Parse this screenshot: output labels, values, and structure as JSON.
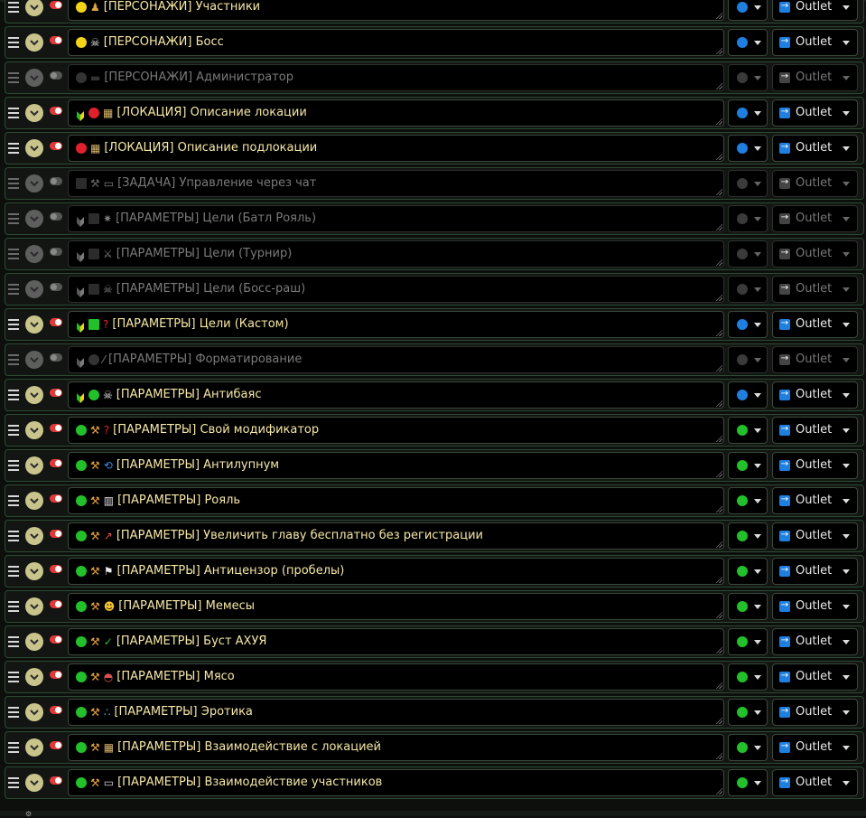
{
  "colors": {
    "accent_blue": "#1e7fe0",
    "active_green": "#22c02a",
    "toggle_red": "#e23a3a",
    "name_text": "#f6e8a6"
  },
  "rows": [
    {
      "enabled": true,
      "icons": [
        "yellow-dot-icon",
        "person-icon"
      ],
      "name": "[ПЕРСОНАЖИ] Участники",
      "color": "#1e7fe0",
      "target": "Outlet"
    },
    {
      "enabled": true,
      "icons": [
        "yellow-dot-icon",
        "skull-icon"
      ],
      "name": "[ПЕРСОНАЖИ] Босс",
      "color": "#1e7fe0",
      "target": "Outlet"
    },
    {
      "enabled": false,
      "icons": [
        "grey-dot-icon",
        "top-hat-icon"
      ],
      "name": "[ПЕРСОНАЖИ] Администратор",
      "color": "#3a3a3a",
      "target": "Outlet"
    },
    {
      "enabled": true,
      "icons": [
        "leaf-icon",
        "red-dot-icon",
        "map-icon"
      ],
      "name": "[ЛОКАЦИЯ] Описание локации",
      "color": "#1e7fe0",
      "target": "Outlet"
    },
    {
      "enabled": true,
      "icons": [
        "red-dot-icon",
        "map-icon"
      ],
      "name": "[ЛОКАЦИЯ] Описание подлокации",
      "color": "#1e7fe0",
      "target": "Outlet"
    },
    {
      "enabled": false,
      "icons": [
        "grey-square-icon",
        "wrench-icon",
        "speech-bubble-icon"
      ],
      "name": "[ЗАДАЧА] Управление через чат",
      "color": "#3a3a3a",
      "target": "Outlet"
    },
    {
      "enabled": false,
      "icons": [
        "leaf-icon",
        "grey-square-icon",
        "burst-icon"
      ],
      "name": "[ПАРАМЕТРЫ] Цели (Батл Рояль)",
      "color": "#3a3a3a",
      "target": "Outlet"
    },
    {
      "enabled": false,
      "icons": [
        "leaf-icon",
        "grey-square-icon",
        "crossed-swords-icon"
      ],
      "name": "[ПАРАМЕТРЫ] Цели (Турнир)",
      "color": "#3a3a3a",
      "target": "Outlet"
    },
    {
      "enabled": false,
      "icons": [
        "leaf-icon",
        "grey-square-icon",
        "skull-crossbones-icon"
      ],
      "name": "[ПАРАМЕТРЫ] Цели (Босс-раш)",
      "color": "#3a3a3a",
      "target": "Outlet"
    },
    {
      "enabled": true,
      "icons": [
        "leaf-icon",
        "green-square-icon",
        "question-icon"
      ],
      "name": "[ПАРАМЕТРЫ] Цели (Кастом)",
      "color": "#1e7fe0",
      "target": "Outlet"
    },
    {
      "enabled": false,
      "icons": [
        "leaf-icon",
        "grey-dot-icon",
        "feather-icon"
      ],
      "name": "[ПАРАМЕТРЫ] Форматирование",
      "color": "#3a3a3a",
      "target": "Outlet"
    },
    {
      "enabled": true,
      "icons": [
        "leaf-icon",
        "green-dot-icon",
        "skull-icon"
      ],
      "name": "[ПАРАМЕТРЫ] Антибаяс",
      "color": "#1e7fe0",
      "target": "Outlet"
    },
    {
      "enabled": true,
      "icons": [
        "green-dot-icon",
        "wrench-icon",
        "question-icon"
      ],
      "name": "[ПАРАМЕТРЫ] Свой модификатор",
      "color": "#22c02a",
      "target": "Outlet"
    },
    {
      "enabled": true,
      "icons": [
        "green-dot-icon",
        "wrench-icon",
        "repeat-icon"
      ],
      "name": "[ПАРАМЕТРЫ] Антилупнум",
      "color": "#22c02a",
      "target": "Outlet"
    },
    {
      "enabled": true,
      "icons": [
        "green-dot-icon",
        "wrench-icon",
        "piano-icon"
      ],
      "name": "[ПАРАМЕТРЫ] Рояль",
      "color": "#22c02a",
      "target": "Outlet"
    },
    {
      "enabled": true,
      "icons": [
        "green-dot-icon",
        "wrench-icon",
        "chart-up-icon"
      ],
      "name": "[ПАРАМЕТРЫ] Увеличить главу бесплатно без регистрации",
      "color": "#22c02a",
      "target": "Outlet"
    },
    {
      "enabled": true,
      "icons": [
        "green-dot-icon",
        "wrench-icon",
        "pirate-flag-icon"
      ],
      "name": "[ПАРАМЕТРЫ] Антицензор (пробелы)",
      "color": "#22c02a",
      "target": "Outlet"
    },
    {
      "enabled": true,
      "icons": [
        "green-dot-icon",
        "wrench-icon",
        "grin-icon"
      ],
      "name": "[ПАРАМЕТРЫ] Мемесы",
      "color": "#22c02a",
      "target": "Outlet"
    },
    {
      "enabled": true,
      "icons": [
        "green-dot-icon",
        "wrench-icon",
        "check-icon"
      ],
      "name": "[ПАРАМЕТРЫ] Буст АХУЯ",
      "color": "#22c02a",
      "target": "Outlet"
    },
    {
      "enabled": true,
      "icons": [
        "green-dot-icon",
        "wrench-icon",
        "meat-icon"
      ],
      "name": "[ПАРАМЕТРЫ] Мясо",
      "color": "#22c02a",
      "target": "Outlet"
    },
    {
      "enabled": true,
      "icons": [
        "green-dot-icon",
        "wrench-icon",
        "droplets-icon"
      ],
      "name": "[ПАРАМЕТРЫ] Эротика",
      "color": "#22c02a",
      "target": "Outlet"
    },
    {
      "enabled": true,
      "icons": [
        "green-dot-icon",
        "wrench-icon",
        "map-icon"
      ],
      "name": "[ПАРАМЕТРЫ] Взаимодействие с локацией",
      "color": "#22c02a",
      "target": "Outlet"
    },
    {
      "enabled": true,
      "icons": [
        "green-dot-icon",
        "wrench-icon",
        "speech-bubble-icon"
      ],
      "name": "[ПАРАМЕТРЫ] Взаимодействие участников",
      "color": "#22c02a",
      "target": "Outlet"
    }
  ]
}
